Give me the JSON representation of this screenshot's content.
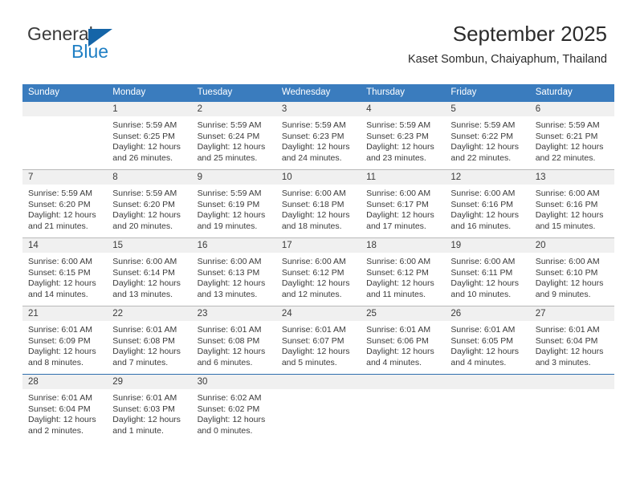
{
  "brand": {
    "name_part1": "General",
    "name_part2": "Blue",
    "accent_color": "#1f7fc4",
    "triangle_color": "#1565a8"
  },
  "header": {
    "title": "September 2025",
    "subtitle": "Kaset Sombun, Chaiyaphum, Thailand",
    "header_bg": "#3a7cbe",
    "date_band_bg": "#f0f0f0"
  },
  "weekday_headers": [
    "Sunday",
    "Monday",
    "Tuesday",
    "Wednesday",
    "Thursday",
    "Friday",
    "Saturday"
  ],
  "weeks": [
    [
      {
        "date": "",
        "sunrise": "",
        "sunset": "",
        "daylight_line1": "",
        "daylight_line2": ""
      },
      {
        "date": "1",
        "sunrise": "Sunrise: 5:59 AM",
        "sunset": "Sunset: 6:25 PM",
        "daylight_line1": "Daylight: 12 hours",
        "daylight_line2": "and 26 minutes."
      },
      {
        "date": "2",
        "sunrise": "Sunrise: 5:59 AM",
        "sunset": "Sunset: 6:24 PM",
        "daylight_line1": "Daylight: 12 hours",
        "daylight_line2": "and 25 minutes."
      },
      {
        "date": "3",
        "sunrise": "Sunrise: 5:59 AM",
        "sunset": "Sunset: 6:23 PM",
        "daylight_line1": "Daylight: 12 hours",
        "daylight_line2": "and 24 minutes."
      },
      {
        "date": "4",
        "sunrise": "Sunrise: 5:59 AM",
        "sunset": "Sunset: 6:23 PM",
        "daylight_line1": "Daylight: 12 hours",
        "daylight_line2": "and 23 minutes."
      },
      {
        "date": "5",
        "sunrise": "Sunrise: 5:59 AM",
        "sunset": "Sunset: 6:22 PM",
        "daylight_line1": "Daylight: 12 hours",
        "daylight_line2": "and 22 minutes."
      },
      {
        "date": "6",
        "sunrise": "Sunrise: 5:59 AM",
        "sunset": "Sunset: 6:21 PM",
        "daylight_line1": "Daylight: 12 hours",
        "daylight_line2": "and 22 minutes."
      }
    ],
    [
      {
        "date": "7",
        "sunrise": "Sunrise: 5:59 AM",
        "sunset": "Sunset: 6:20 PM",
        "daylight_line1": "Daylight: 12 hours",
        "daylight_line2": "and 21 minutes."
      },
      {
        "date": "8",
        "sunrise": "Sunrise: 5:59 AM",
        "sunset": "Sunset: 6:20 PM",
        "daylight_line1": "Daylight: 12 hours",
        "daylight_line2": "and 20 minutes."
      },
      {
        "date": "9",
        "sunrise": "Sunrise: 5:59 AM",
        "sunset": "Sunset: 6:19 PM",
        "daylight_line1": "Daylight: 12 hours",
        "daylight_line2": "and 19 minutes."
      },
      {
        "date": "10",
        "sunrise": "Sunrise: 6:00 AM",
        "sunset": "Sunset: 6:18 PM",
        "daylight_line1": "Daylight: 12 hours",
        "daylight_line2": "and 18 minutes."
      },
      {
        "date": "11",
        "sunrise": "Sunrise: 6:00 AM",
        "sunset": "Sunset: 6:17 PM",
        "daylight_line1": "Daylight: 12 hours",
        "daylight_line2": "and 17 minutes."
      },
      {
        "date": "12",
        "sunrise": "Sunrise: 6:00 AM",
        "sunset": "Sunset: 6:16 PM",
        "daylight_line1": "Daylight: 12 hours",
        "daylight_line2": "and 16 minutes."
      },
      {
        "date": "13",
        "sunrise": "Sunrise: 6:00 AM",
        "sunset": "Sunset: 6:16 PM",
        "daylight_line1": "Daylight: 12 hours",
        "daylight_line2": "and 15 minutes."
      }
    ],
    [
      {
        "date": "14",
        "sunrise": "Sunrise: 6:00 AM",
        "sunset": "Sunset: 6:15 PM",
        "daylight_line1": "Daylight: 12 hours",
        "daylight_line2": "and 14 minutes."
      },
      {
        "date": "15",
        "sunrise": "Sunrise: 6:00 AM",
        "sunset": "Sunset: 6:14 PM",
        "daylight_line1": "Daylight: 12 hours",
        "daylight_line2": "and 13 minutes."
      },
      {
        "date": "16",
        "sunrise": "Sunrise: 6:00 AM",
        "sunset": "Sunset: 6:13 PM",
        "daylight_line1": "Daylight: 12 hours",
        "daylight_line2": "and 13 minutes."
      },
      {
        "date": "17",
        "sunrise": "Sunrise: 6:00 AM",
        "sunset": "Sunset: 6:12 PM",
        "daylight_line1": "Daylight: 12 hours",
        "daylight_line2": "and 12 minutes."
      },
      {
        "date": "18",
        "sunrise": "Sunrise: 6:00 AM",
        "sunset": "Sunset: 6:12 PM",
        "daylight_line1": "Daylight: 12 hours",
        "daylight_line2": "and 11 minutes."
      },
      {
        "date": "19",
        "sunrise": "Sunrise: 6:00 AM",
        "sunset": "Sunset: 6:11 PM",
        "daylight_line1": "Daylight: 12 hours",
        "daylight_line2": "and 10 minutes."
      },
      {
        "date": "20",
        "sunrise": "Sunrise: 6:00 AM",
        "sunset": "Sunset: 6:10 PM",
        "daylight_line1": "Daylight: 12 hours",
        "daylight_line2": "and 9 minutes."
      }
    ],
    [
      {
        "date": "21",
        "sunrise": "Sunrise: 6:01 AM",
        "sunset": "Sunset: 6:09 PM",
        "daylight_line1": "Daylight: 12 hours",
        "daylight_line2": "and 8 minutes."
      },
      {
        "date": "22",
        "sunrise": "Sunrise: 6:01 AM",
        "sunset": "Sunset: 6:08 PM",
        "daylight_line1": "Daylight: 12 hours",
        "daylight_line2": "and 7 minutes."
      },
      {
        "date": "23",
        "sunrise": "Sunrise: 6:01 AM",
        "sunset": "Sunset: 6:08 PM",
        "daylight_line1": "Daylight: 12 hours",
        "daylight_line2": "and 6 minutes."
      },
      {
        "date": "24",
        "sunrise": "Sunrise: 6:01 AM",
        "sunset": "Sunset: 6:07 PM",
        "daylight_line1": "Daylight: 12 hours",
        "daylight_line2": "and 5 minutes."
      },
      {
        "date": "25",
        "sunrise": "Sunrise: 6:01 AM",
        "sunset": "Sunset: 6:06 PM",
        "daylight_line1": "Daylight: 12 hours",
        "daylight_line2": "and 4 minutes."
      },
      {
        "date": "26",
        "sunrise": "Sunrise: 6:01 AM",
        "sunset": "Sunset: 6:05 PM",
        "daylight_line1": "Daylight: 12 hours",
        "daylight_line2": "and 4 minutes."
      },
      {
        "date": "27",
        "sunrise": "Sunrise: 6:01 AM",
        "sunset": "Sunset: 6:04 PM",
        "daylight_line1": "Daylight: 12 hours",
        "daylight_line2": "and 3 minutes."
      }
    ],
    [
      {
        "date": "28",
        "sunrise": "Sunrise: 6:01 AM",
        "sunset": "Sunset: 6:04 PM",
        "daylight_line1": "Daylight: 12 hours",
        "daylight_line2": "and 2 minutes."
      },
      {
        "date": "29",
        "sunrise": "Sunrise: 6:01 AM",
        "sunset": "Sunset: 6:03 PM",
        "daylight_line1": "Daylight: 12 hours",
        "daylight_line2": "and 1 minute."
      },
      {
        "date": "30",
        "sunrise": "Sunrise: 6:02 AM",
        "sunset": "Sunset: 6:02 PM",
        "daylight_line1": "Daylight: 12 hours",
        "daylight_line2": "and 0 minutes."
      },
      {
        "date": "",
        "sunrise": "",
        "sunset": "",
        "daylight_line1": "",
        "daylight_line2": ""
      },
      {
        "date": "",
        "sunrise": "",
        "sunset": "",
        "daylight_line1": "",
        "daylight_line2": ""
      },
      {
        "date": "",
        "sunrise": "",
        "sunset": "",
        "daylight_line1": "",
        "daylight_line2": ""
      },
      {
        "date": "",
        "sunrise": "",
        "sunset": "",
        "daylight_line1": "",
        "daylight_line2": ""
      }
    ]
  ]
}
